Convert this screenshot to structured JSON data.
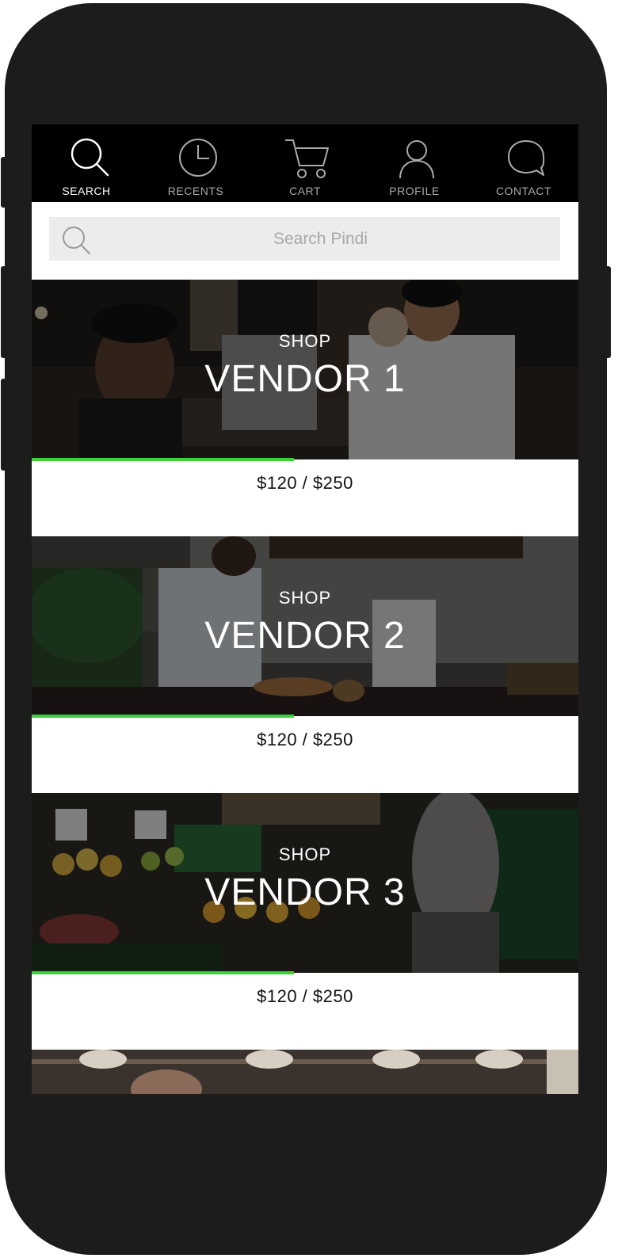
{
  "tabs": [
    {
      "label": "SEARCH",
      "icon": "search-icon",
      "active": true
    },
    {
      "label": "RECENTS",
      "icon": "clock-icon",
      "active": false
    },
    {
      "label": "CART",
      "icon": "cart-icon",
      "active": false
    },
    {
      "label": "PROFILE",
      "icon": "user-icon",
      "active": false
    },
    {
      "label": "CONTACT",
      "icon": "chat-bubble-icon",
      "active": false
    }
  ],
  "search": {
    "placeholder": "Search Pindi",
    "value": ""
  },
  "vendors": [
    {
      "shop_label": "SHOP",
      "name": "VENDOR 1",
      "amount": "$120 / $250",
      "progress": 0.48
    },
    {
      "shop_label": "SHOP",
      "name": "VENDOR 2",
      "amount": "$120 / $250",
      "progress": 0.48
    },
    {
      "shop_label": "SHOP",
      "name": "VENDOR 3",
      "amount": "$120 / $250",
      "progress": 0.48
    }
  ],
  "colors": {
    "accent": "#3ad13a",
    "tabbar": "#000000",
    "phone_frame": "#1c1c1c",
    "search_bg": "#ececec"
  }
}
